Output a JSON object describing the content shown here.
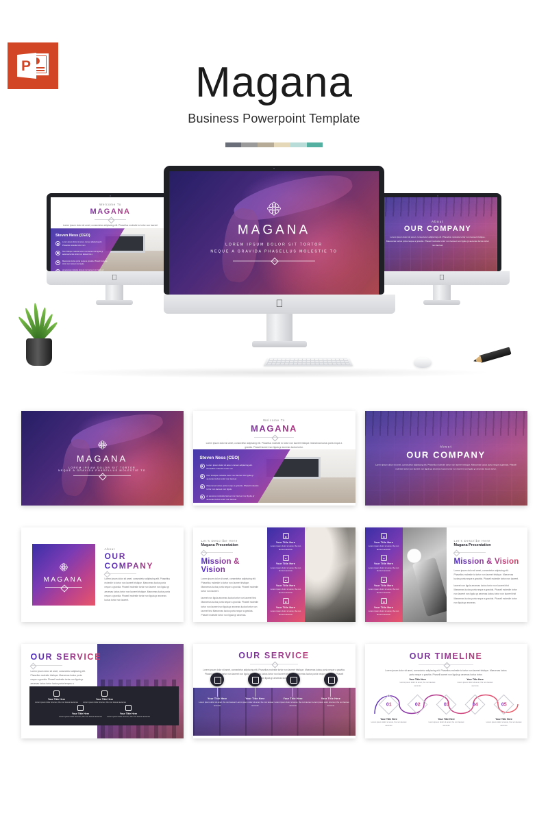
{
  "badge": {
    "icon": "powerpoint-icon",
    "letter": "P",
    "color": "#d24625"
  },
  "hero": {
    "title": "Magana",
    "subtitle": "Business Powerpoint Template",
    "swatches": [
      "#6a6e78",
      "#9a9a9a",
      "#b5ab97",
      "#e4d8b8",
      "#b8dcd8",
      "#54b0a0"
    ]
  },
  "brand": {
    "gradient_start": "#3a2fa6",
    "gradient_mid": "#b8418f",
    "gradient_end": "#e8556a",
    "dark": "#24242e"
  },
  "showcase": {
    "center_slide": {
      "logo": "flower-logo-icon",
      "title": "MAGANA",
      "subtitle_line1": "LOREM IPSUM DOLOR SIT TORTOR",
      "subtitle_line2": "NEQUE A GRAVIDA PHASELLUS MOLESTIE TO"
    },
    "left_slide": {
      "eyebrow": "Welcome To",
      "title": "MAGANA",
      "paragraph": "Lorem ipsum dolor sit amet, consectetur adipiscing elit. Phasellus molestie to tortor non laoreet tristique. Maecenas luctus porta neque a gravida. Phasell laoreet non ligula gr aecenas luctus tortor.",
      "section_title": "Steven Ness (CEO)",
      "bullets": [
        "Lorem ipsum dolor sit amet, consec adipiscing elit. Phasellus molestie tortor non",
        "Non tristique molestie tortor non laoreet tris ligula gr aecenas luctus tortor non laoreet tris e",
        "Maecenas luctus porta neque a gravida. Phasell molestie tortor non laoreet non ligula",
        "gr aecenas molestie laoreet non laoreet non ligula gr aecenas luctus tortor non laoree"
      ]
    },
    "right_slide": {
      "eyebrow": "About",
      "title": "OUR COMPANY",
      "paragraph": "Lorem ipsum dolor sit amet, consectetur adipiscing elit. Phasellus molestie tortor non laoreet tristique. Maecenas luctus porta neque a gravida. Phasell molestie tortor non laoreet non ligula gr aecenas luctus tortor non laoreet."
    },
    "desk_props": [
      "plant",
      "keyboard",
      "mouse",
      "pencil"
    ]
  },
  "slides": [
    {
      "id": "slide-title",
      "layout": "hero-photo",
      "photo": "woman-with-hat",
      "logo": "flower-logo-icon",
      "title": "MAGANA",
      "sub1": "LOREM IPSUM DOLOR SIT TORTOR",
      "sub2": "NEQUE A GRAVIDA PHASELLUS MOLESTIE TO"
    },
    {
      "id": "slide-welcome",
      "layout": "welcome-ceo",
      "eyebrow": "Welcome To",
      "title": "MAGANA",
      "paragraph": "Lorem ipsum dolor sit amet, consectetur adipiscing elit. Phasellus molestie to tortor non laoreet tristique. Maecenas luctus porta neque a gravida. Phasell laoreet non ligula gr aecenas luctus tortor.",
      "section_title": "Steven Ness (CEO)",
      "photo": "living-room",
      "bullets": [
        "Lorem ipsum dolor sit amet, consec adipiscing elit. Phasellus molestie tortor non",
        "Non tristique molestie tortor non laoreet tris ligula gr aecenas luctus tortor non laoreet",
        "Maecenas luctus porta neque a gravida. Phasell molestie tortor non laoreet non ligula",
        "gr aecenas molestie laoreet non laoreet non ligula gr aecenas luctus tortor non laoreet"
      ]
    },
    {
      "id": "slide-about-photo",
      "layout": "about-fullphoto",
      "photo": "office-building-interior",
      "eyebrow": "About",
      "title": "OUR COMPANY",
      "paragraph": "Lorem ipsum dolor sit amet, consectetur adipiscing elit. Phasellus molestie tortor non laoreet tristique. Maecenas luctus porta neque a gravida. Phasell molestie tortor non laoreet non ligula gr aecenas luctus tortor non laoreet non ligula gr aecenas luctus tortor."
    },
    {
      "id": "slide-about-split",
      "layout": "about-split",
      "logo": "flower-logo-icon",
      "brand": "MAGANA",
      "eyebrow": "About",
      "title": "OUR COMPANY",
      "paragraph": "Lorem ipsum dolor sit amet, consectetur adipiscing elit. Phasellus molestie to tortor non laoreet tristique. Maecenas luctus porta neque a gravida. Phasell molestie tortor non laoreet non ligula gr aecenas luctus tortor non laoreet tristique. Maecenas luctus porta neque a gravida. Phasell molestie tortor non ligula gr aecenas luctus tortor non laoreet."
    },
    {
      "id": "slide-mission-right-photo",
      "layout": "mission-left-text",
      "eyebrow": "Let's Describe Here",
      "kicker": "Magana Presentation",
      "title": "Mission & Vision",
      "paragraph1": "Lorem ipsum dolor sit amet, consectetur adipiscing elit. Phasellus molestie to tortor non laoreet tristique. Maecenas luctus porta neque a gravida. Phasell molestie tortor non laoreet.",
      "paragraph2": "laoreet non ligula aecenas luctus tortor non laoreet trist Maecenas luctus porta neque a gravida. Phasell molestie tortor non laoreet non ligula gr aecenas luctus tortor non laoreet trist Maecenas luctus porta neque a gravida. Phasell molestie tortor non ligula gr aecenas.",
      "photo": "notebook-and-pen",
      "features": [
        {
          "icon": "gear-icon",
          "title": "Your Title Here",
          "text": "Lorem ipsum dolor sit amet, the non laoreet aecenas"
        },
        {
          "icon": "chart-icon",
          "title": "Your Title Here",
          "text": "Lorem ipsum dolor sit amet, the non laoreet aecenas"
        },
        {
          "icon": "bank-icon",
          "title": "Your Title Here",
          "text": "Lorem ipsum dolor sit amet, the non laoreet aecenas"
        },
        {
          "icon": "camera-icon",
          "title": "Your Title Here",
          "text": "Lorem ipsum dolor sit amet, the non laoreet aecenas"
        }
      ]
    },
    {
      "id": "slide-mission-left-photo",
      "layout": "mission-right-text",
      "eyebrow": "Let's Describe Here",
      "kicker": "Magana Presentation",
      "title": "Mission & Vision",
      "paragraph1": "Lorem ipsum dolor sit amet, consectetur adipiscing elit. Phasellus molestie to tortor non laoreet tristique. Maecenas luctus porta neque a gravida. Phasell molestie tortor non laoreet.",
      "paragraph2": "laoreet non ligula aecenas luctus tortor non laoreet trist Maecenas luctus porta neque a gravida. Phasell molestie tortor non laoreet non ligula gr aecenas luctus tortor non laoreet trist Maecenas luctus porta neque a gravida. Phasell molestie tortor non ligula gr aecenas.",
      "photo": "coffee-and-tablet",
      "features": [
        {
          "icon": "bank-icon",
          "title": "Your Title Here",
          "text": "Lorem ipsum dolor sit amet, the non laoreet aecenas"
        },
        {
          "icon": "chart-icon",
          "title": "Your Title Here",
          "text": "Lorem ipsum dolor sit amet, the non laoreet aecenas"
        },
        {
          "icon": "building-icon",
          "title": "Your Title Here",
          "text": "Lorem ipsum dolor sit amet, the non laoreet aecenas"
        },
        {
          "icon": "camera-icon",
          "title": "Your Title Here",
          "text": "Lorem ipsum dolor sit amet, the non laoreet aecenas"
        }
      ]
    },
    {
      "id": "slide-service-dark",
      "layout": "service-dark-panel",
      "title": "OUR SERVICE",
      "paragraph": "Lorem ipsum dolor sit amet, consectetur adipiscing elit. Phasellus molestie tristique. Maecenas luctus porta neque a gravida. Phasell molestie tortor non ligula gr aecenas luctus tortor luctus porta tempus a.",
      "photo": "city-skyline",
      "items": [
        {
          "icon": "bank-icon",
          "title": "Your Title Here",
          "text": "Lorem ipsum dolor sit amet, the non laoreet aecenas"
        },
        {
          "icon": "chart-icon",
          "title": "Your Title Here",
          "text": "Lorem ipsum dolor sit amet, the non laoreet aecenas"
        },
        {
          "icon": "building-icon",
          "title": "Your Title Here",
          "text": "Lorem ipsum dolor sit amet, the non laoreet aecenas"
        },
        {
          "icon": "camera-icon",
          "title": "Your Title Here",
          "text": "Lorem ipsum dolor sit amet, the non laoreet aecenas"
        }
      ]
    },
    {
      "id": "slide-service-icons",
      "layout": "service-icon-row",
      "title": "OUR SERVICE",
      "paragraph": "Lorem ipsum dolor sit amet, consectetur adipiscing elit. Phasellus molestie tortor non laoreet tristique. Maecenas luctus porta neque a gravida. Phasell molestie tortor non laoreet non ligula gr aecenas luctus tortor non laoreet tristique. Maecenas luctus porta neque a gravida. Phasell laoreet non ligula gr aecenas luctus tortor.",
      "photo": "office-window-people",
      "items": [
        {
          "icon": "bank-icon",
          "title": "Your Title Here",
          "text": "Lorem ipsum dolor sit amet, the non laoreet aecenas"
        },
        {
          "icon": "diamond-icon",
          "title": "Your Title Here",
          "text": "Lorem ipsum dolor sit amet, the non laoreet aecenas"
        },
        {
          "icon": "building-icon",
          "title": "Your Title Here",
          "text": "Lorem ipsum dolor sit amet, the non laoreet aecenas"
        },
        {
          "icon": "chart-icon",
          "title": "Your Title Here",
          "text": "Lorem ipsum dolor sit amet, the non laoreet aecenas"
        }
      ]
    },
    {
      "id": "slide-timeline",
      "layout": "timeline",
      "title": "OUR TIMELINE",
      "paragraph": "Lorem ipsum dolor sit amet, consectetur adipiscing elit. Phasellus molestie to tortor non laoreet tristique. Maecenas luctus porta neque a gravida. Phasell laoreet non ligula gr aecenas luctus tortor.",
      "steps": [
        {
          "number": "01",
          "position": "below",
          "title": "Your Title Here",
          "text": "Lorem ipsum dolor sit amet, the non laoreet aecenas"
        },
        {
          "number": "02",
          "position": "above",
          "title": "Your Title Here",
          "text": "Lorem ipsum dolor sit amet, the non laoreet aecenas"
        },
        {
          "number": "03",
          "position": "below",
          "title": "Your Title Here",
          "text": "Lorem ipsum dolor sit amet, the non laoreet aecenas"
        },
        {
          "number": "04",
          "position": "above",
          "title": "Your Title Here",
          "text": "Lorem ipsum dolor sit amet, the non laoreet aecenas"
        },
        {
          "number": "05",
          "position": "below",
          "title": "Your Title Here",
          "text": "Lorem ipsum dolor sit amet, the non laoreet aecenas"
        }
      ]
    }
  ]
}
